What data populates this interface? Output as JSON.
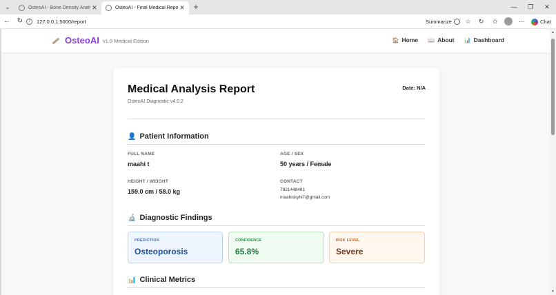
{
  "browser": {
    "tabs": [
      {
        "title": "OsteoAI - Bone Density Analysis",
        "active": false
      },
      {
        "title": "OsteoAI - Final Medical Report",
        "active": true
      }
    ],
    "url": "127.0.0.1:5000/report",
    "summarize_label": "Summarize",
    "chat_label": "Chat"
  },
  "header": {
    "brand": "OsteoAI",
    "version": "v1.0 Medical Edition",
    "nav": [
      {
        "icon": "🏠",
        "label": "Home"
      },
      {
        "icon": "📖",
        "label": "About"
      },
      {
        "icon": "📊",
        "label": "Dashboard"
      }
    ]
  },
  "report": {
    "title": "Medical Analysis Report",
    "subtitle": "OsteoAI Diagnostic v4.0.2",
    "date": "Date: N/A",
    "patient_section": {
      "icon": "👤",
      "title": "Patient Information",
      "full_name_label": "FULL NAME",
      "full_name": "maahi t",
      "age_sex_label": "AGE / SEX",
      "age_sex": "50 years / Female",
      "height_weight_label": "HEIGHT / WEIGHT",
      "height_weight": "159.0 cm / 58.0 kg",
      "contact_label": "CONTACT",
      "phone": "7921448461",
      "email": "maahiskyhi7@gmail.com"
    },
    "findings_section": {
      "icon": "🔬",
      "title": "Diagnostic Findings",
      "prediction_label": "PREDICTION",
      "prediction": "Osteoporosis",
      "confidence_label": "CONFIDENCE",
      "confidence": "65.8%",
      "risk_label": "RISK LEVEL",
      "risk": "Severe"
    },
    "metrics_section": {
      "icon": "📊",
      "title": "Clinical Metrics"
    }
  }
}
